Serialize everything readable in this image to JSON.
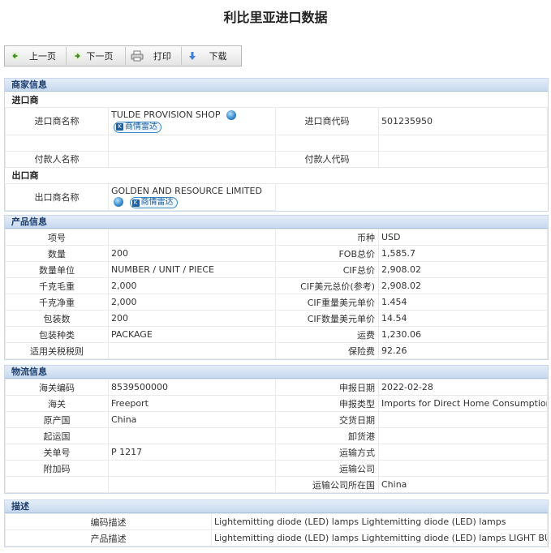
{
  "page_title": "利比里亚进口数据",
  "toolbar": {
    "prev": "上一页",
    "next": "下一页",
    "print": "打印",
    "download": "下载"
  },
  "radar_label": "商情雷达",
  "merchant": {
    "header": "商家信息",
    "importer_section": "进口商",
    "importer_name_label": "进口商名称",
    "importer_name": "TULDE PROVISION SHOP",
    "importer_code_label": "进口商代码",
    "importer_code": "501235950",
    "payer_name_label": "付款人名称",
    "payer_code_label": "付款人代码",
    "exporter_section": "出口商",
    "exporter_name_label": "出口商名称",
    "exporter_name": "GOLDEN AND RESOURCE LIMITED"
  },
  "product": {
    "header": "产品信息",
    "rows": [
      {
        "l1": "项号",
        "v1": "",
        "l2": "币种",
        "v2": "USD"
      },
      {
        "l1": "数量",
        "v1": "200",
        "l2": "FOB总价",
        "v2": "1,585.7"
      },
      {
        "l1": "数量单位",
        "v1": "NUMBER / UNIT / PIECE",
        "l2": "CIF总价",
        "v2": "2,908.02"
      },
      {
        "l1": "千克毛重",
        "v1": "2,000",
        "l2": "CIF美元总价(参考)",
        "v2": "2,908.02"
      },
      {
        "l1": "千克净重",
        "v1": "2,000",
        "l2": "CIF重量美元单价",
        "v2": "1.454"
      },
      {
        "l1": "包装数",
        "v1": "200",
        "l2": "CIF数量美元单价",
        "v2": "14.54"
      },
      {
        "l1": "包装种类",
        "v1": "PACKAGE",
        "l2": "运费",
        "v2": "1,230.06"
      },
      {
        "l1": "适用关税税则",
        "v1": "",
        "l2": "保险费",
        "v2": "92.26"
      }
    ]
  },
  "logistics": {
    "header": "物流信息",
    "rows": [
      {
        "l1": "海关编码",
        "v1": "8539500000",
        "l2": "申报日期",
        "v2": "2022-02-28"
      },
      {
        "l1": "海关",
        "v1": "Freeport",
        "l2": "申报类型",
        "v2": "Imports for Direct Home Consumption"
      },
      {
        "l1": "原产国",
        "v1": "China",
        "l2": "交货日期",
        "v2": ""
      },
      {
        "l1": "起运国",
        "v1": "",
        "l2": "卸货港",
        "v2": ""
      },
      {
        "l1": "关单号",
        "v1": "P 1217",
        "l2": "运输方式",
        "v2": ""
      },
      {
        "l1": "附加码",
        "v1": "",
        "l2": "运输公司",
        "v2": ""
      },
      {
        "l1": "",
        "v1": "",
        "l2": "运输公司所在国",
        "v2": "China"
      }
    ]
  },
  "description": {
    "header": "描述",
    "code_desc_label": "编码描述",
    "code_desc": "Lightemitting diode (LED) lamps Lightemitting diode (LED) lamps",
    "product_desc_label": "产品描述",
    "product_desc": "Lightemitting diode (LED) lamps Lightemitting diode (LED) lamps LIGHT BULB"
  }
}
